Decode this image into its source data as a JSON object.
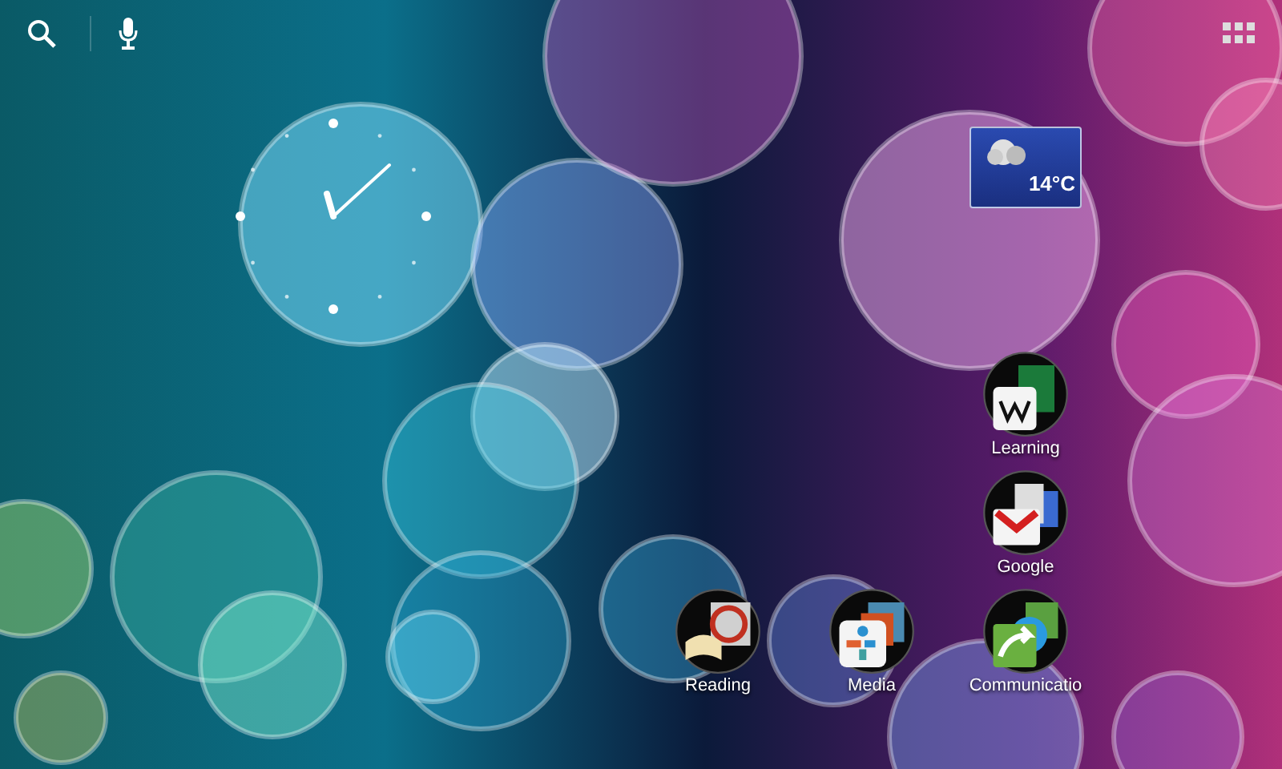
{
  "weather_widget": {
    "temperature": "14°C"
  },
  "folders": [
    {
      "label": "Learning",
      "kind": "learning"
    },
    {
      "label": "Google",
      "kind": "google"
    },
    {
      "label": "Reading",
      "kind": "reading"
    },
    {
      "label": "Media",
      "kind": "media"
    },
    {
      "label": "Communicatio",
      "kind": "communication"
    }
  ]
}
